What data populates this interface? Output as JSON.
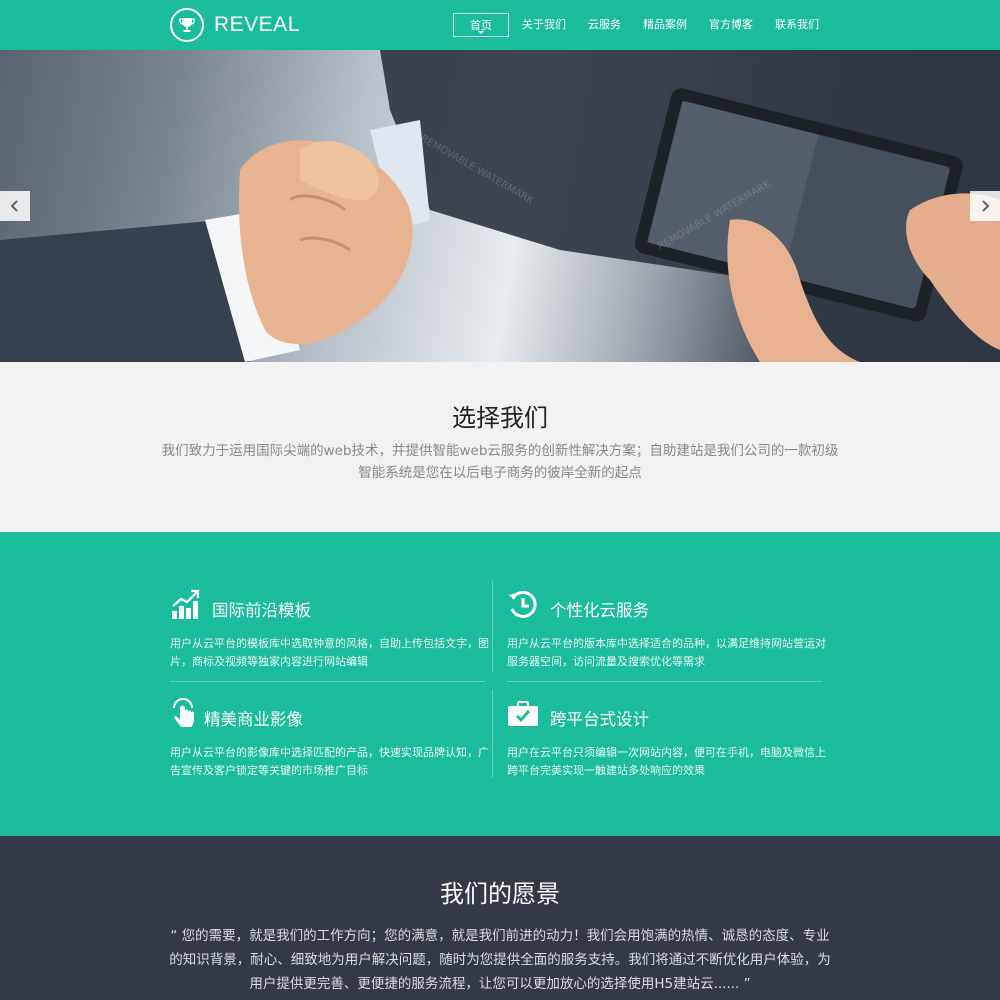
{
  "header": {
    "brand": "REVEAL",
    "nav": [
      "首页",
      "关于我们",
      "云服务",
      "精品案例",
      "官方博客",
      "联系我们"
    ]
  },
  "colors": {
    "primary": "#1abc9c",
    "dark": "#333946",
    "light_bg": "#f2f2f2"
  },
  "banner": {
    "prev_icon": "chevron-left-icon",
    "next_icon": "chevron-right-icon"
  },
  "choose": {
    "title": "选择我们",
    "text": "我们致力于运用国际尖端的web技术，并提供智能web云服务的创新性解决方案；自助建站是我们公司的一款初级智能系统是您在以后电子商务的彼岸全新的起点"
  },
  "features": [
    {
      "icon": "chart-growth-icon",
      "title": "国际前沿模板",
      "text": "用户从云平台的模板库中选取钟意的风格，自助上传包括文字，图片，商标及视频等独家内容进行网站编辑"
    },
    {
      "icon": "history-clock-icon",
      "title": "个性化云服务",
      "text": "用户从云平台的版本库中选择适合的品种，以满足维持网站营运对服务器空间，访问流量及搜索优化等需求"
    },
    {
      "icon": "touch-hand-icon",
      "title": "精美商业影像",
      "text": "用户从云平台的影像库中选择匹配的产品，快速实现品牌认知，广告宣传及客户锁定等关键的市场推广目标"
    },
    {
      "icon": "briefcase-check-icon",
      "title": "跨平台式设计",
      "text": "用户在云平台只须编辑一次网站内容，便可在手机，电脑及微信上跨平台完美实现一触建站多处响应的效果"
    }
  ],
  "vision": {
    "title": "我们的愿景",
    "text": "“ 您的需要，就是我们的工作方向；您的满意，就是我们前进的动力！我们会用饱满的热情、诚恳的态度、专业的知识背景，耐心、细致地为用户解决问题，随时为您提供全面的服务支持。我们将通过不断优化用户体验，为用户提供更完善、更便捷的服务流程，让您可以更加放心的选择使用H5建站云...... ”"
  }
}
